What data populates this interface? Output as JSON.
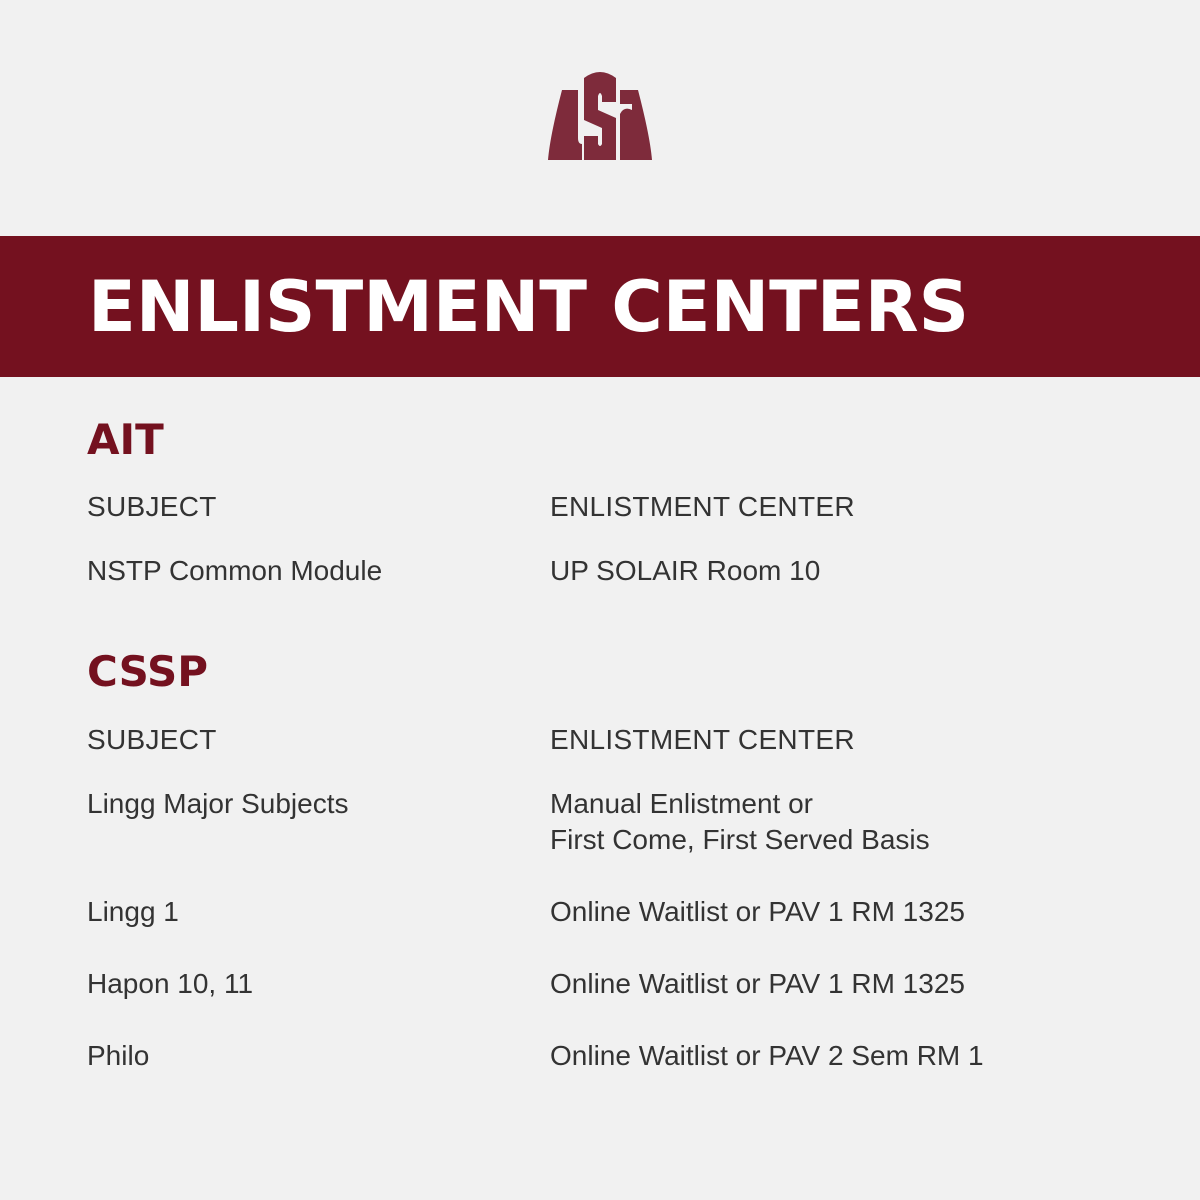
{
  "logo": {
    "text": "USC",
    "color": "#7e2b3b"
  },
  "banner": {
    "title": "ENLISTMENT CENTERS",
    "color": "#74111f"
  },
  "sections": [
    {
      "title": "AIT",
      "headers": {
        "subject": "SUBJECT",
        "center": "ENLISTMENT CENTER"
      },
      "rows": [
        {
          "subject": "NSTP Common Module",
          "center": [
            "UP SOLAIR Room 10"
          ]
        }
      ]
    },
    {
      "title": "CSSP",
      "headers": {
        "subject": "SUBJECT",
        "center": "ENLISTMENT CENTER"
      },
      "rows": [
        {
          "subject": "Lingg Major Subjects",
          "center": [
            "Manual Enlistment or",
            "First Come, First Served Basis"
          ]
        },
        {
          "subject": "Lingg 1",
          "center": [
            "Online Waitlist or PAV 1 RM 1325"
          ]
        },
        {
          "subject": "Hapon 10, 11",
          "center": [
            "Online Waitlist or PAV 1 RM 1325"
          ]
        },
        {
          "subject": "Philo",
          "center": [
            "Online Waitlist or PAV 2 Sem RM 1"
          ]
        }
      ]
    }
  ]
}
